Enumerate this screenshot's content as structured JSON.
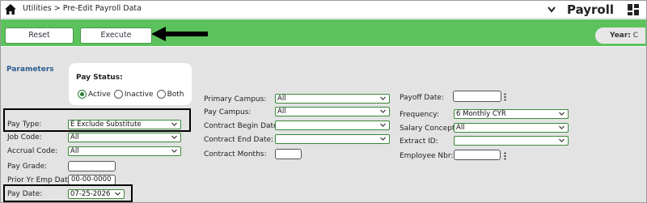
{
  "header": {
    "breadcrumb": "Utilities > Pre-Edit Payroll Data",
    "module": "Payroll"
  },
  "toolbar": {
    "reset_label": "Reset",
    "execute_label": "Execute",
    "year_label": "Year:",
    "year_value": "C"
  },
  "params": {
    "title": "Parameters",
    "pay_status": {
      "title": "Pay Status:",
      "options": [
        "Active",
        "Inactive",
        "Both"
      ],
      "selected": "Active"
    },
    "pay_type": {
      "label": "Pay Type:",
      "value": "E Exclude Substitute"
    },
    "job_code": {
      "label": "Job Code:",
      "value": "All"
    },
    "accrual_code": {
      "label": "Accrual Code:",
      "value": "All"
    },
    "pay_grade": {
      "label": "Pay Grade:",
      "value": ""
    },
    "prior_yr_emp_date": {
      "label": "Prior Yr Emp Date:",
      "value": "00-00-0000"
    },
    "pay_date": {
      "label": "Pay Date:",
      "value": "07-25-2026"
    },
    "primary_campus": {
      "label": "Primary Campus:",
      "value": "All"
    },
    "pay_campus": {
      "label": "Pay Campus:",
      "value": "All"
    },
    "contract_begin_date": {
      "label": "Contract Begin Date:",
      "value": ""
    },
    "contract_end_date": {
      "label": "Contract End Date:",
      "value": ""
    },
    "contract_months": {
      "label": "Contract Months:",
      "value": ""
    },
    "payoff_date": {
      "label": "Payoff Date:",
      "value": ""
    },
    "frequency": {
      "label": "Frequency:",
      "value": "6 Monthly CYR"
    },
    "salary_concept": {
      "label": "Salary Concept:",
      "value": "All"
    },
    "extract_id": {
      "label": "Extract ID:",
      "value": ""
    },
    "employee_nbr": {
      "label": "Employee Nbr:",
      "value": ""
    }
  },
  "colors": {
    "accent_green": "#5cc25c",
    "field_border": "#3a8a3a",
    "params_title": "#2a5d8f"
  }
}
